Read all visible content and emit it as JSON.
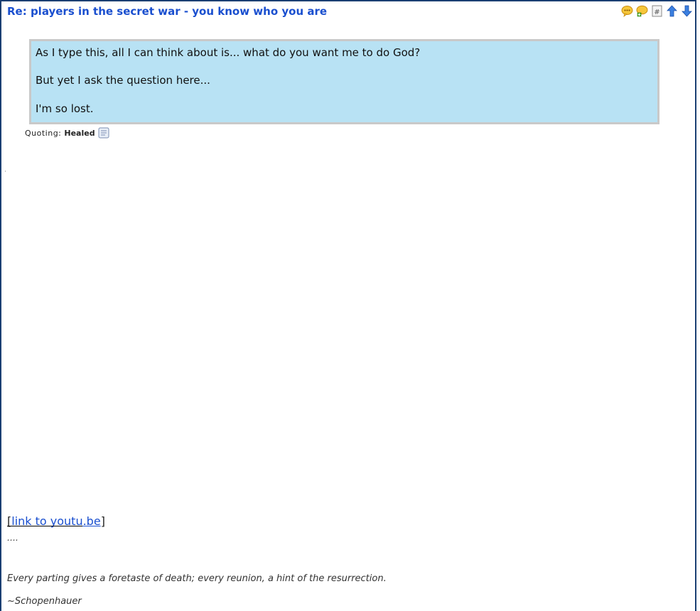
{
  "post": {
    "title": "Re: players in the secret war - you know who you are",
    "icons": [
      "quote-reply-icon",
      "add-reply-icon",
      "permalink-icon",
      "scroll-up-icon",
      "scroll-down-icon"
    ]
  },
  "quote": {
    "lines": [
      "As I type this, all I can think about is... what do you want me to do God?",
      "But yet I ask the question here...",
      "I'm so lost."
    ],
    "label": "Quoting:",
    "author": "Healed"
  },
  "body": {
    "link_open": "[",
    "link_text": "link to youtu.be",
    "link_close": "]"
  },
  "signature": {
    "dots": "….",
    "quote": "Every parting gives a foretaste of death; every reunion, a hint of the resurrection.",
    "author": "~Schopenhauer"
  },
  "colors": {
    "title": "#1a4fcf",
    "quote_bg": "#b8e2f4",
    "frame": "#1a3f73"
  }
}
